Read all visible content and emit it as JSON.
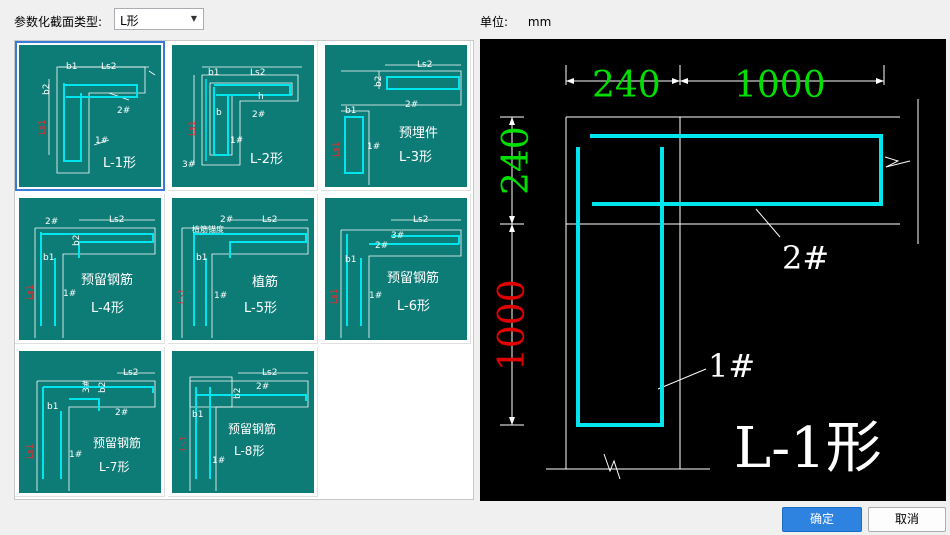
{
  "header": {
    "section_type_label": "参数化截面类型:",
    "section_type_value": "L形",
    "unit_label": "单位:",
    "unit_value": "mm"
  },
  "shapes": [
    {
      "name": "L-1形",
      "note": ""
    },
    {
      "name": "L-2形",
      "note": ""
    },
    {
      "name": "L-3形",
      "note": "预埋件"
    },
    {
      "name": "L-4形",
      "note": "预留钢筋"
    },
    {
      "name": "L-5形",
      "note": "植筋"
    },
    {
      "name": "L-6形",
      "note": "预留钢筋"
    },
    {
      "name": "L-7形",
      "note": "预留钢筋"
    },
    {
      "name": "L-8形",
      "note": "预留钢筋"
    }
  ],
  "selected_index": 0,
  "thumb_labels": {
    "b1": "b1",
    "b2": "b2",
    "ls1": "Ls1",
    "ls2": "Ls2",
    "bar1": "1#",
    "bar2": "2#",
    "bar3": "3#",
    "h": "h",
    "b": "b",
    "anchor": "植筋锚度"
  },
  "preview": {
    "dim_b1": "240",
    "dim_ls2": "1000",
    "dim_b2": "240",
    "dim_ls1": "1000",
    "bar1": "1#",
    "bar2": "2#",
    "title": "L-1形"
  },
  "buttons": {
    "ok": "确定",
    "cancel": "取消"
  },
  "colors": {
    "thumb_bg": "#0d7b76",
    "rebar": "#00e5ee",
    "dim_green": "#00e000",
    "dim_red": "#e00000",
    "ok_button": "#2e82e0"
  }
}
